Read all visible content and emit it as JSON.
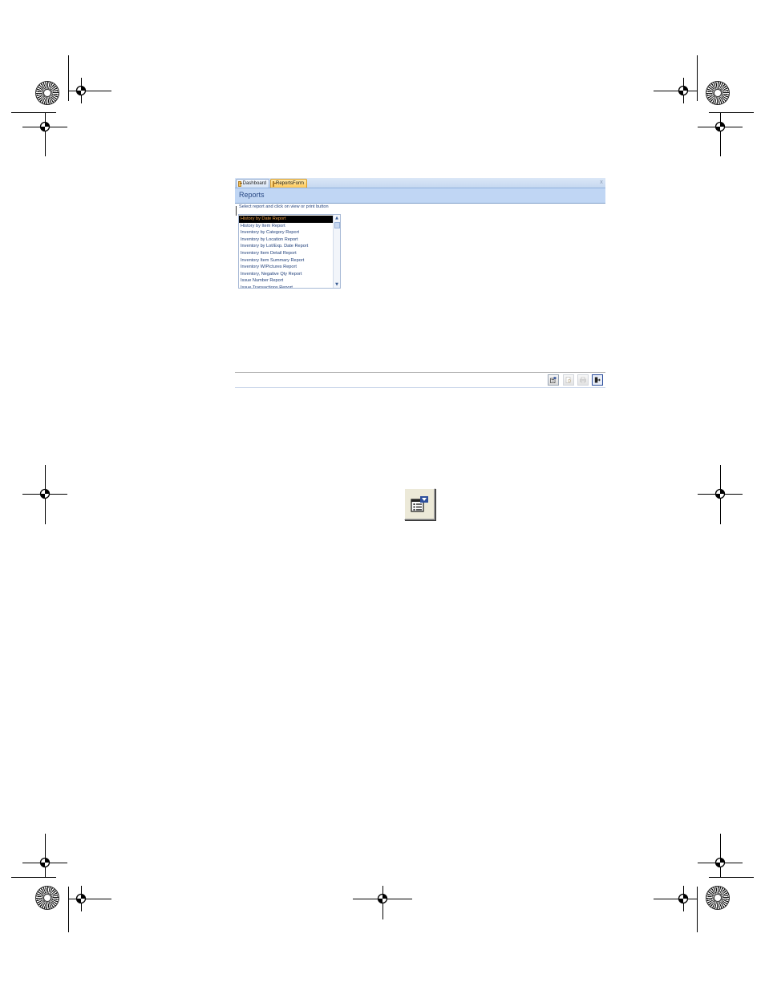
{
  "tabs": [
    {
      "label": "Dashboard",
      "active": false
    },
    {
      "label": "ReportsForm",
      "active": true
    }
  ],
  "close_glyph": "x",
  "form": {
    "title": "Reports",
    "instruction": "Select report and click on view or print button"
  },
  "report_list": {
    "selected_index": 0,
    "items": [
      "History by Date Report",
      "History by Item Report",
      "Inventory by Category Report",
      "Inventory by Location Report",
      "Inventory by Lot/Exp. Date Report",
      "Inventory Item Detail Report",
      "Inventory Item Summary Report",
      "Inventory W/Pictures Report",
      "Inventory, Negative Qty Report",
      "Issue Number Report",
      "Issue Transactions Report"
    ]
  },
  "toolbar_buttons": [
    {
      "name": "report-properties-button",
      "icon": "report-properties-icon",
      "enabled": true
    },
    {
      "name": "preview-button",
      "icon": "preview-icon",
      "enabled": false
    },
    {
      "name": "print-button",
      "icon": "printer-icon",
      "enabled": false
    },
    {
      "name": "exit-button",
      "icon": "exit-door-icon",
      "enabled": true
    }
  ],
  "callout_icon": "report-properties-icon",
  "colors": {
    "header_bg": "#c0d6f4",
    "header_text": "#2a4a85",
    "active_tab": "#ffc95a",
    "selection_bg": "#000000",
    "selection_text": "#f0a24a"
  }
}
